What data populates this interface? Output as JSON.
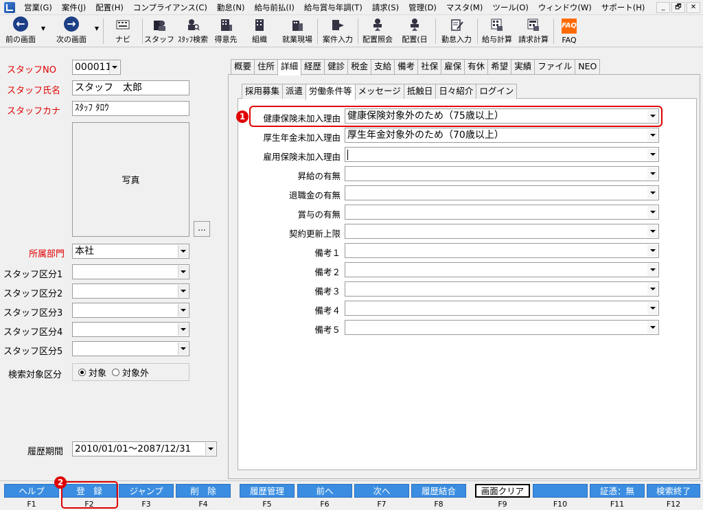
{
  "menubar": {
    "items": [
      "営業(G)",
      "案件(J)",
      "配置(H)",
      "コンプライアンス(C)",
      "勤怠(N)",
      "給与前払(I)",
      "給与賞与年調(T)",
      "請求(S)",
      "管理(D)",
      "マスタ(M)",
      "ツール(O)",
      "ウィンドウ(W)",
      "サポート(H)"
    ],
    "win_buttons": [
      "_",
      "🗗",
      "✕"
    ]
  },
  "toolbar": {
    "back": "前の画面",
    "forward": "次の画面",
    "navi": "ナビ",
    "staff": "スタッフ",
    "staff_search": "ｽﾀｯﾌ検索",
    "client": "得意先",
    "org": "組織",
    "site": "就業現場",
    "case_input": "案件入力",
    "placement_inquiry": "配置照会",
    "placement_day": "配置(日",
    "attendance_input": "勤怠入力",
    "payroll": "給与計算",
    "billing": "請求計算",
    "faq": "FAQ",
    "faq_icon": "FAQ"
  },
  "staff": {
    "no_label": "スタッフNO",
    "no_value": "000011",
    "name_label": "スタッフ氏名",
    "name_value": "スタッフ　太郎",
    "kana_label": "スタッフカナ",
    "kana_value": "ｽﾀｯﾌ ﾀﾛｳ",
    "photo_label": "写真",
    "photo_button": "...",
    "dept_label": "所属部門",
    "dept_value": "本社",
    "class1_label": "スタッフ区分1",
    "class2_label": "スタッフ区分2",
    "class3_label": "スタッフ区分3",
    "class4_label": "スタッフ区分4",
    "class5_label": "スタッフ区分5",
    "search_target_label": "検索対象区分",
    "radio_target": "対象",
    "radio_non_target": "対象外",
    "history_label": "履歴期間",
    "history_value": "2010/01/01～2087/12/31"
  },
  "tabs_main": [
    "概要",
    "住所",
    "詳細",
    "経歴",
    "健診",
    "税金",
    "支給",
    "備考",
    "社保",
    "雇保",
    "有休",
    "希望",
    "実績",
    "ファイル",
    "NEO"
  ],
  "tabs_sub": [
    "採用募集",
    "派遣",
    "労働条件等",
    "メッセージ",
    "抵触日",
    "日々紹介",
    "ログイン"
  ],
  "form": {
    "health_label": "健康保険未加入理由",
    "health_value": "健康保険対象外のため（75歳以上）",
    "pension_label": "厚生年金未加入理由",
    "pension_value": "厚生年金対象外のため（70歳以上）",
    "employment_label": "雇用保険未加入理由",
    "raise_label": "昇給の有無",
    "retire_label": "退職金の有無",
    "bonus_label": "賞与の有無",
    "renewal_label": "契約更新上限",
    "note1_label": "備考１",
    "note2_label": "備考２",
    "note3_label": "備考３",
    "note4_label": "備考４",
    "note5_label": "備考５"
  },
  "markers": [
    "1",
    "2"
  ],
  "fkeys": {
    "f1": "ヘルプ",
    "f1_key": "F1",
    "f2": "登　録",
    "f2_key": "F2",
    "f3": "ジャンプ",
    "f3_key": "F3",
    "f4": "削　除",
    "f4_key": "F4",
    "f5": "履歴管理",
    "f5_key": "F5",
    "f6": "前へ",
    "f6_key": "F6",
    "f7": "次へ",
    "f7_key": "F7",
    "f8": "履歴結合",
    "f8_key": "F8",
    "f9": "画面クリア",
    "f9_key": "F9",
    "f10": "",
    "f10_key": "F10",
    "f11": "証憑：無",
    "f11_key": "F11",
    "f12": "検索終了",
    "f12_key": "F12"
  },
  "colors": {
    "accent_red": "#e00000",
    "fkey_blue": "#3a8de0"
  }
}
